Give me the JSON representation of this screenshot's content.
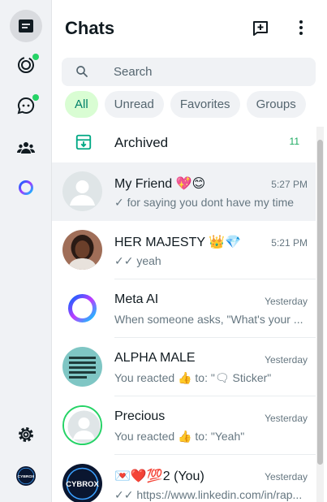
{
  "header": {
    "title": "Chats"
  },
  "search": {
    "placeholder": "Search"
  },
  "filters": [
    "All",
    "Unread",
    "Favorites",
    "Groups"
  ],
  "archived": {
    "label": "Archived",
    "count": "11"
  },
  "chats": [
    {
      "name": "My Friend 💖😊",
      "time": "5:27 PM",
      "preview": "✓ for saying you dont have my time"
    },
    {
      "name": "HER MAJESTY 👑💎",
      "time": "5:21 PM",
      "preview": "✓✓ yeah"
    },
    {
      "name": "Meta AI",
      "time": "Yesterday",
      "preview": "When someone asks, \"What's your ..."
    },
    {
      "name": "ALPHA MALE",
      "time": "Yesterday",
      "preview": "You reacted 👍 to: \"🗨 Sticker\""
    },
    {
      "name": "Precious",
      "time": "Yesterday",
      "preview": "You reacted 👍 to: \"Yeah\""
    },
    {
      "name": "💌❤️💯2 (You)",
      "time": "Yesterday",
      "preview": "✓✓ https://www.linkedin.com/in/rap..."
    }
  ],
  "profile": {
    "avatar_text": "CYBROX"
  },
  "colors": {
    "accent": "#25d366",
    "chip_active_bg": "#d9fdd3",
    "chip_active_text": "#008069",
    "unread_count": "#1daa61"
  }
}
